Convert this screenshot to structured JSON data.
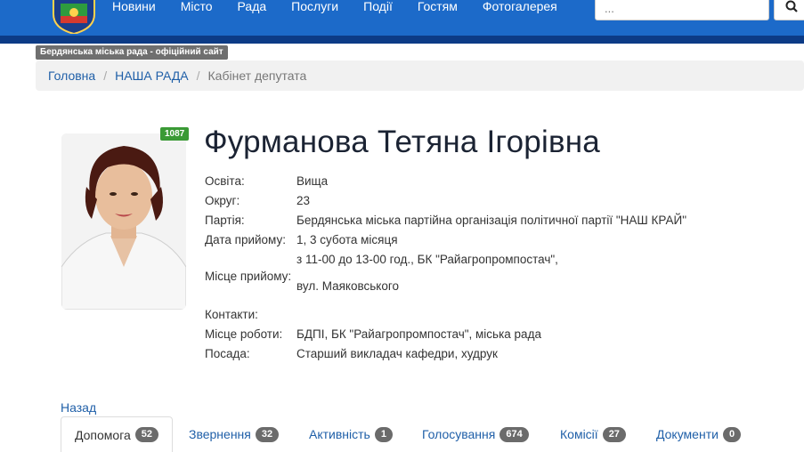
{
  "nav": {
    "items": [
      "Новини",
      "Місто",
      "Рада",
      "Послуги",
      "Події",
      "Гостям",
      "Фотогалерея"
    ],
    "search_placeholder": "...",
    "search_icon": "search-icon",
    "logo_icon": "city-coat-of-arms"
  },
  "site_badge": "Бердянська міська рада - офіційний сайт",
  "breadcrumb": {
    "home": "Головна",
    "section": "НАША РАДА",
    "current": "Кабінет депутата",
    "separator": "/"
  },
  "deputy": {
    "rating": "1087",
    "name": "Фурманова Тетяна Ігорівна",
    "photo_icon": "deputy-photo"
  },
  "info": {
    "education_label": "Освіта:",
    "education": "Вища",
    "district_label": "Округ:",
    "district": "23",
    "party_label": "Партія:",
    "party": "Бердянська міська партійна організація політичної партії \"НАШ КРАЙ\"",
    "reception_date_label": "Дата прийому:",
    "reception_date": "1, 3 субота місяця",
    "reception_place_label": "Місце прийому:",
    "reception_place_line1": "з 11-00 до 13-00 год., БК \"Райагропромпостач\",",
    "reception_place_line2": "вул. Маяковського",
    "contacts_label": "Контакти:",
    "work_label": "Місце роботи:",
    "work": "БДПІ, БК \"Райагропромпостач\", міська рада",
    "position_label": "Посада:",
    "position": "Старший викладач кафедри, худрук"
  },
  "back_label": "Назад",
  "tabs": [
    {
      "label": "Допомога",
      "count": "52"
    },
    {
      "label": "Звернення",
      "count": "32"
    },
    {
      "label": "Активність",
      "count": "1"
    },
    {
      "label": "Голосування",
      "count": "674"
    },
    {
      "label": "Комісії",
      "count": "27"
    },
    {
      "label": "Документи",
      "count": "0"
    }
  ],
  "colors": {
    "navbar": "#1c6ac9",
    "navbar_stripe": "#0c3b86",
    "link": "#1f5fa8",
    "rating_badge": "#3a9a35",
    "count_badge": "#6b6b6b"
  }
}
